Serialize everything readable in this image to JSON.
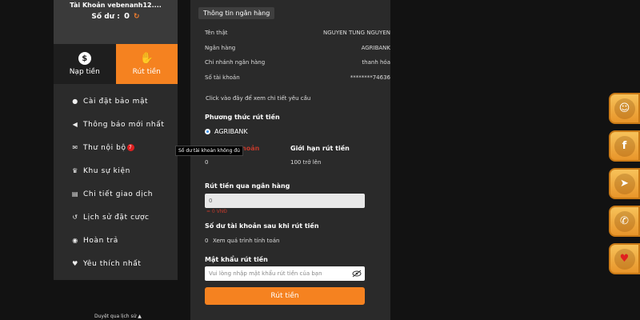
{
  "account": {
    "name": "Tài Khoản vebenanh12....",
    "balance_label": "Số dư :",
    "balance_value": "0"
  },
  "tabs": {
    "deposit": "Nạp tiền",
    "withdraw": "Rút tiền"
  },
  "menu": [
    {
      "icon": "person-icon",
      "label": "Cài đặt bảo mật"
    },
    {
      "icon": "megaphone-icon",
      "label": "Thông báo mới nhất"
    },
    {
      "icon": "envelope-icon",
      "label": "Thư nội bộ",
      "badge": "7"
    },
    {
      "icon": "trophy-icon",
      "label": "Khu sự kiện"
    },
    {
      "icon": "clipboard-icon",
      "label": "Chi tiết giao dịch"
    },
    {
      "icon": "history-icon",
      "label": "Lịch sử đặt cược"
    },
    {
      "icon": "refund-icon",
      "label": "Hoàn trả"
    },
    {
      "icon": "heart-icon",
      "label": "Yêu thích nhất"
    }
  ],
  "tooltip": "Số dư tài khoản không đủ",
  "bottom_link": "Duyệt qua lịch sử ▲",
  "bank": {
    "title": "Thông tin ngân hàng",
    "rows": [
      {
        "label": "Tên thật",
        "value": "NGUYEN TUNG NGUYEN"
      },
      {
        "label": "Ngân hàng",
        "value": "AGRIBANK"
      },
      {
        "label": "Chi nhánh ngân hàng",
        "value": "thanh hóa"
      },
      {
        "label": "Số tài khoản",
        "value": "********74636"
      }
    ],
    "hint": "Click vào đây để xem chi tiết yêu cầu"
  },
  "withdraw": {
    "method_label": "Phương thức rút tiền",
    "method_option": "AGRIBANK",
    "balance_col_label": "hoản",
    "balance_col_value": "0",
    "limit_col_label": "Giới hạn rút tiền",
    "limit_col_value": "100 trở lên",
    "amount_label": "Rút tiền qua ngân hàng",
    "amount_value": "0",
    "amount_vnd": "= 0 VNĐ",
    "after_label": "Số dư tài khoản sau khi rút tiền",
    "after_value": "0",
    "after_note": "Xem quá trình tính toán",
    "password_label": "Mật khẩu rút tiền",
    "password_placeholder": "Vui lòng nhập mật khẩu rút tiền của bạn",
    "submit": "Rút tiền"
  },
  "side_buttons": [
    "support-icon",
    "facebook-icon",
    "telegram-icon",
    "phone-icon",
    "heart-hand-icon"
  ],
  "colors": {
    "accent": "#f58220",
    "panel": "#2a2a2a",
    "gold": "#f2b048"
  }
}
